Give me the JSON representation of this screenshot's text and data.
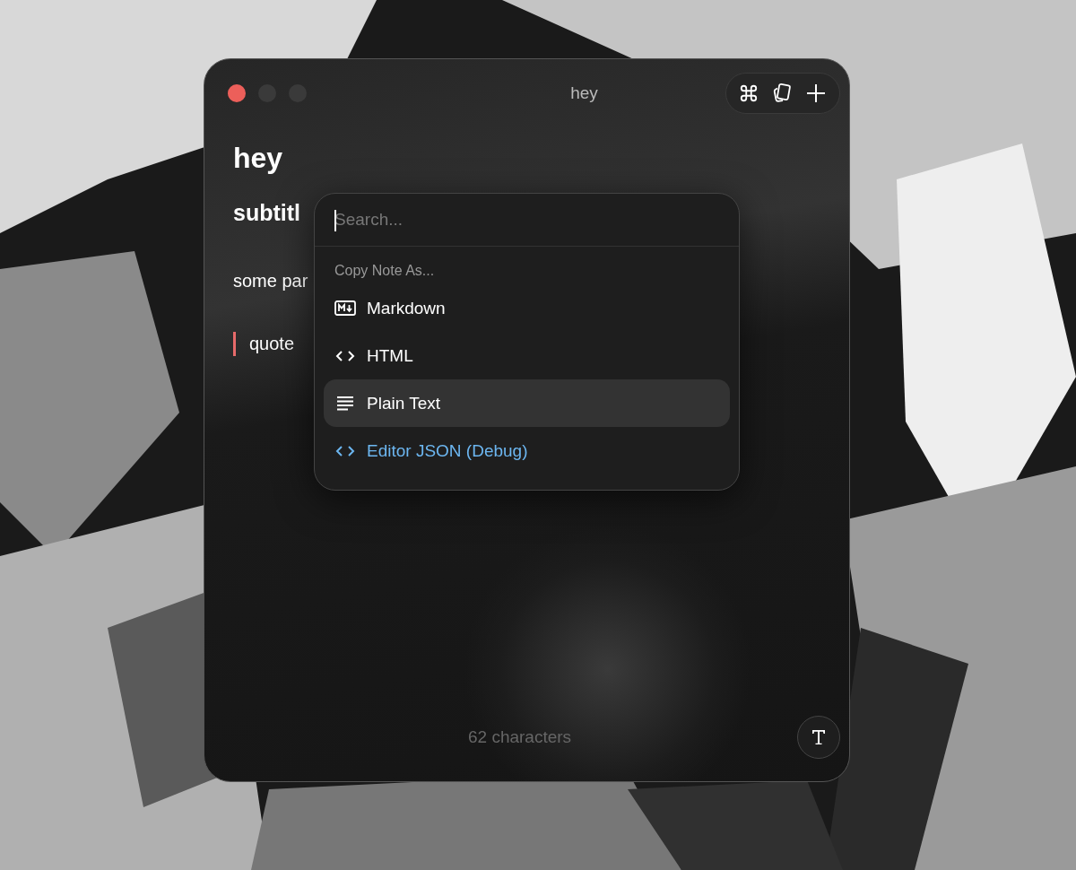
{
  "window": {
    "title": "hey",
    "traffic_lights": [
      {
        "color": "#ec5f5a"
      },
      {
        "color": "#3a3a3a"
      },
      {
        "color": "#3a3a3a"
      }
    ]
  },
  "editor": {
    "heading": "hey",
    "subheading": "subtitl",
    "paragraph": "some par",
    "quote": "quote"
  },
  "menu": {
    "search": {
      "placeholder": "Search..."
    },
    "section": "Copy Note As...",
    "items": [
      {
        "label": "Markdown",
        "kind": "markdown",
        "selected": false
      },
      {
        "label": "HTML",
        "kind": "code",
        "selected": false
      },
      {
        "label": "Plain Text",
        "kind": "lines",
        "selected": true
      },
      {
        "label": "Editor JSON (Debug)",
        "kind": "debug",
        "selected": false
      }
    ]
  },
  "status_bar": {
    "count": "62 characters"
  }
}
